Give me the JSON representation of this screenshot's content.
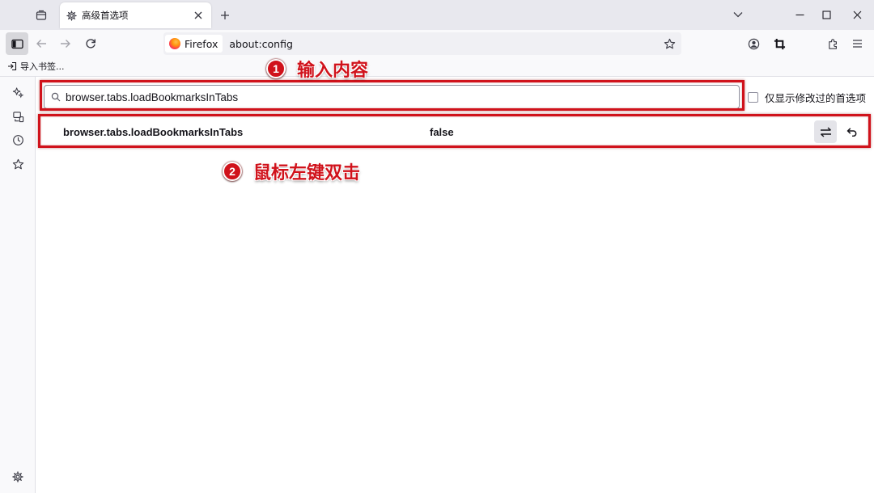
{
  "tab": {
    "title": "高级首选项"
  },
  "urlbar": {
    "identity_label": "Firefox",
    "url": "about:config"
  },
  "bookmarks": {
    "import_label": "导入书签..."
  },
  "config": {
    "search_value": "browser.tabs.loadBookmarksInTabs",
    "modified_only_label": "仅显示修改过的首选项",
    "pref": {
      "name": "browser.tabs.loadBookmarksInTabs",
      "value": "false"
    }
  },
  "annotations": {
    "step1": {
      "number": "1",
      "text": "输入内容"
    },
    "step2": {
      "number": "2",
      "text": "鼠标左键双击"
    },
    "highlight_color": "#d0121b"
  },
  "icons": {
    "tab": "gear-icon",
    "tab_list": "tab-list-icon",
    "nav": [
      "back-icon",
      "forward-icon",
      "reload-icon"
    ],
    "toolbar_right": [
      "account-icon",
      "screenshot-icon",
      "extensions-icon",
      "menu-icon"
    ],
    "sidebar": [
      "ai-chat-icon",
      "synced-tabs-icon",
      "history-icon",
      "bookmarks-icon",
      "settings-icon"
    ]
  }
}
